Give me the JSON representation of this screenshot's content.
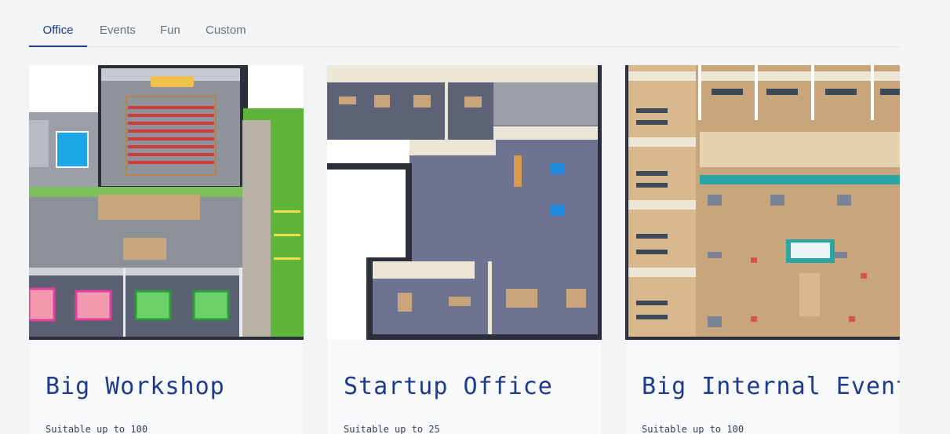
{
  "tabs": [
    {
      "label": "Office",
      "active": true
    },
    {
      "label": "Events",
      "active": false
    },
    {
      "label": "Fun",
      "active": false
    },
    {
      "label": "Custom",
      "active": false
    }
  ],
  "cards": [
    {
      "title": "Big Workshop",
      "meta": "Suitable up to 100"
    },
    {
      "title": "Startup Office",
      "meta": "Suitable up to 25"
    },
    {
      "title": "Big Internal Event",
      "meta": "Suitable up to 100"
    }
  ],
  "colors": {
    "accent": "#1e3a8a",
    "page_bg": "#f3f4f6",
    "floor_gray": "#8a8f99",
    "carpet_blue": "#6b7191",
    "wood_floor": "#c9a57c",
    "grass": "#5fb43a"
  }
}
